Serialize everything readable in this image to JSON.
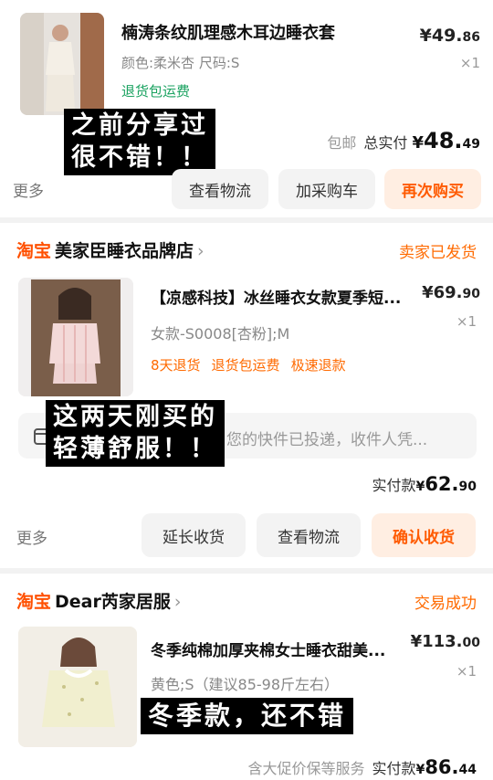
{
  "orders": [
    {
      "title": "楠涛条纹肌理感木耳边睡衣套",
      "spec": "颜色:柔米杏 尺码:S",
      "tags": [
        "退货包运费"
      ],
      "price_int": "¥49.",
      "price_dec": "86",
      "qty": "×1",
      "summary_muted": "包邮",
      "summary_label": "总实付",
      "summary_sym": "¥",
      "summary_int": "48.",
      "summary_dec": "49",
      "more": "更多",
      "buttons": [
        "查看物流",
        "加采购车",
        "再次购买"
      ],
      "overlay": [
        "之前分享过",
        "很不错！！"
      ]
    },
    {
      "brand": "淘宝",
      "shop": "美家臣睡衣品牌店",
      "chev": "›",
      "status": "卖家已发货",
      "title": "【凉感科技】冰丝睡衣女款夏季短...",
      "spec": "女款-S0008[杏粉];M",
      "tags": [
        "8天退货",
        "退货包运费",
        "极速退款"
      ],
      "price_int": "¥69.",
      "price_dec": "90",
      "qty": "×1",
      "notice": "您的快件已投递，收件人凭...",
      "summary_label": "实付款",
      "summary_sym": "¥",
      "summary_int": "62.",
      "summary_dec": "90",
      "more": "更多",
      "buttons": [
        "延长收货",
        "查看物流",
        "确认收货"
      ],
      "overlay": [
        "这两天刚买的",
        "轻薄舒服！！"
      ]
    },
    {
      "brand": "淘宝",
      "shop": "Dear芮家居服",
      "chev": "›",
      "status": "交易成功",
      "title": "冬季纯棉加厚夹棉女士睡衣甜美...",
      "spec": "黄色;S（建议85-98斤左右）",
      "price_int": "¥113.",
      "price_dec": "00",
      "qty": "×1",
      "summary_muted": "含大促价保等服务",
      "summary_label": "实付款",
      "summary_sym": "¥",
      "summary_int": "86.",
      "summary_dec": "44",
      "overlay": [
        "冬季款，还不错"
      ]
    }
  ],
  "colors": {
    "accent": "#ff5000",
    "green": "#1aa260",
    "orange_btn_bg": "#ffeee2"
  },
  "icons": {
    "package": "package-icon",
    "chevron": "chevron-right-icon"
  }
}
